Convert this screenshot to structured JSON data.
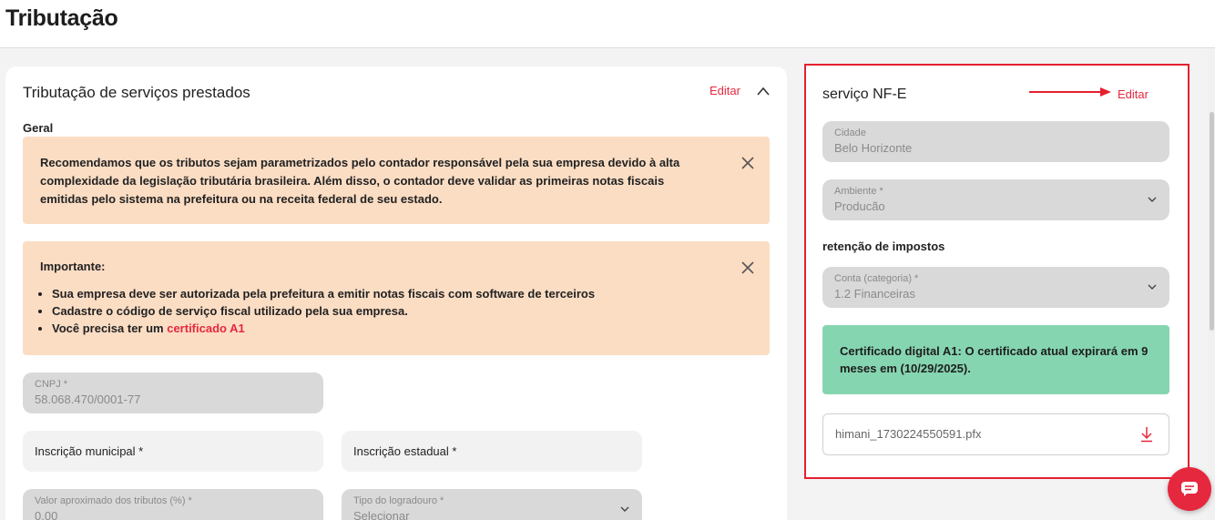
{
  "header": {
    "title": "Tributação"
  },
  "left": {
    "section_title": "Tributação de serviços prestados",
    "edit_label": "Editar",
    "group_label": "Geral",
    "alert_general": "Recomendamos que os tributos sejam parametrizados pelo contador responsável pela sua empresa devido à alta complexidade da legislação tributária brasileira. Além disso, o contador deve validar as primeiras notas fiscais emitidas pelo sistema na prefeitura ou na receita federal de seu estado.",
    "alert_important": {
      "title": "Importante:",
      "item1": "Sua empresa deve ser autorizada pela prefeitura a emitir notas fiscais com software de terceiros",
      "item2": "Cadastre o código de serviço fiscal utilizado pela sua empresa.",
      "item3_prefix": "Você precisa ter um ",
      "item3_link": "certificado A1"
    },
    "fields": {
      "cnpj_label": "CNPJ *",
      "cnpj_value": "58.068.470/0001-77",
      "inscricao_municipal": "Inscrição municipal *",
      "inscricao_estadual": "Inscrição estadual *",
      "valor_label": "Valor aproximado dos tributos (%) *",
      "valor_value": "0.00",
      "logradouro_label": "Tipo do logradouro *",
      "logradouro_value": "Selecionar"
    }
  },
  "right": {
    "title": "serviço NF-E",
    "edit_label": "Editar",
    "cidade_label": "Cidade",
    "cidade_value": "Belo Horizonte",
    "ambiente_label": "Ambiente *",
    "ambiente_value": "Producão",
    "group_label": "retenção de impostos",
    "conta_label": "Conta (categoria) *",
    "conta_value": "1.2 Financeiras",
    "cert_text": "Certificado digital A1: O certificado atual expirará em 9 meses em (10/29/2025).",
    "file_name": "himani_1730224550591.pfx"
  },
  "colors": {
    "accent": "#e5283e",
    "alert": "#fbddc4",
    "success": "#86d5b1",
    "disabled": "#d9d9d9"
  }
}
